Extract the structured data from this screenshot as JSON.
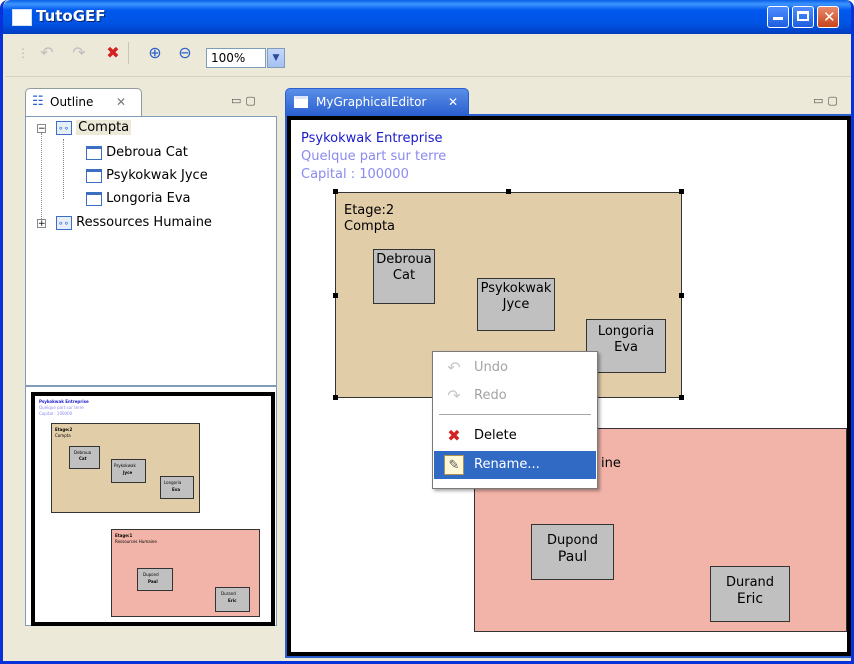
{
  "window": {
    "title": "TutoGEF"
  },
  "toolbar": {
    "zoom_value": "100%"
  },
  "outline": {
    "tab_label": "Outline",
    "tree": [
      {
        "label": "Compta",
        "children": [
          "Debroua Cat",
          "Psykokwak Jyce",
          "Longoria Eva"
        ]
      },
      {
        "label": "Ressources Humaine"
      }
    ]
  },
  "editor": {
    "tab_label": "MyGraphicalEditor",
    "company": {
      "name": "Psykokwak Entreprise",
      "address": "Quelque part sur terre",
      "capital": "Capital : 100000"
    },
    "groups": [
      {
        "etage": "Etage:2",
        "name": "Compta",
        "color": "#e2cda9",
        "employees": [
          {
            "first": "Debroua",
            "last": "Cat"
          },
          {
            "first": "Psykokwak",
            "last": "Jyce"
          },
          {
            "first": "Longoria",
            "last": "Eva"
          }
        ]
      },
      {
        "etage": "Etage:1",
        "name_visible_fragment": "ine",
        "color": "#f2b3a8",
        "employees": [
          {
            "first": "Dupond",
            "last": "Paul"
          },
          {
            "first": "Durand",
            "last": "Eric"
          }
        ]
      }
    ]
  },
  "context_menu": {
    "items": [
      {
        "label": "Undo",
        "enabled": false,
        "icon": "undo-icon"
      },
      {
        "label": "Redo",
        "enabled": false,
        "icon": "redo-icon"
      },
      {
        "label": "Delete",
        "enabled": true,
        "icon": "delete-icon"
      },
      {
        "label": "Rename...",
        "enabled": true,
        "selected": true,
        "icon": "rename-icon"
      }
    ]
  },
  "minimap": {
    "company": "Psykokwak Entreprise",
    "address": "Quelque part sur terre",
    "capital": "Capital : 100000",
    "group1_etage": "Etage:2",
    "group1_name": "Compta",
    "group2_etage": "Etage:1",
    "group2_name": "Ressources Humaine"
  },
  "colors": {
    "title_blue": "#0054e3",
    "selection": "#316ac5",
    "compta_fill": "#e2cda9",
    "rh_fill": "#f2b3a8",
    "employee_fill": "#c0c0c0"
  }
}
